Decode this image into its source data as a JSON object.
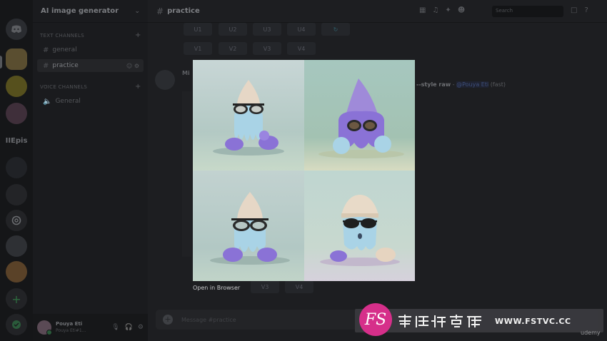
{
  "server": {
    "name": "AI image generator"
  },
  "sidebar": {
    "text_category": "TEXT CHANNELS",
    "voice_category": "VOICE CHANNELS",
    "text_channels": [
      {
        "label": "general",
        "active": false
      },
      {
        "label": "practice",
        "active": true
      }
    ],
    "voice_channels": [
      {
        "label": "General"
      }
    ]
  },
  "rail": {
    "folder_label": "IIEpis"
  },
  "user": {
    "name": "Pouya Eti",
    "status": "Pouya Eti#1..."
  },
  "topbar": {
    "channel": "practice",
    "search_placeholder": "Search"
  },
  "buttons": {
    "row1": [
      "U1",
      "U2",
      "U3",
      "U4"
    ],
    "row2": [
      "V1",
      "V2",
      "V3",
      "V4"
    ],
    "bottom": [
      "V3",
      "V4"
    ]
  },
  "message": {
    "author": "Mi",
    "prompt_tail": "--style raw",
    "mention": "@Pouya Eti",
    "tail_suffix": "(fast)"
  },
  "composer": {
    "placeholder": "Message #practice"
  },
  "lightbox": {
    "open_in_browser": "Open in Browser"
  },
  "watermark": {
    "logo": "FS",
    "url": "WWW.FSTVC.CC",
    "brand_cn": "梵摄创意库"
  },
  "corner_text": "udemy",
  "colors": {
    "accent": "#d62f8a",
    "creature_purple": "#8a72d6",
    "creature_blue": "#a9d3e6",
    "hat_cream": "#e6d7c6"
  }
}
